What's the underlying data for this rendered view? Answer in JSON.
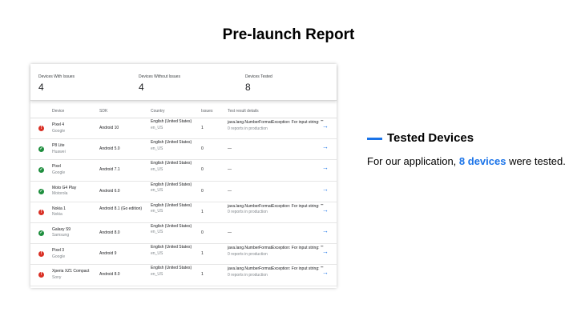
{
  "slide": {
    "title": "Pre-launch Report"
  },
  "summary": [
    {
      "label": "Devices With Issues",
      "value": "4"
    },
    {
      "label": "Devices Without Issues",
      "value": "4"
    },
    {
      "label": "Devices Tested",
      "value": "8"
    }
  ],
  "table": {
    "headers": {
      "device": "Device",
      "sdk": "SDK",
      "country": "Country",
      "issues": "Issues",
      "details": "Test result details"
    },
    "rows": [
      {
        "status": "error",
        "device": "Pixel 4",
        "maker": "Google",
        "sdk": "Android 10",
        "country": "English (United States)",
        "locale": "en_US",
        "issues": "1",
        "details": "java.lang.NumberFormatException: For input string: \"\"",
        "reports": "0 reports in production"
      },
      {
        "status": "ok",
        "device": "P8 Lite",
        "maker": "Huawei",
        "sdk": "Android 5.0",
        "country": "English (United States)",
        "locale": "en_US",
        "issues": "0",
        "details": "—",
        "reports": ""
      },
      {
        "status": "ok",
        "device": "Pixel",
        "maker": "Google",
        "sdk": "Android 7.1",
        "country": "English (United States)",
        "locale": "en_US",
        "issues": "0",
        "details": "—",
        "reports": ""
      },
      {
        "status": "ok",
        "device": "Moto G4 Play",
        "maker": "Motorola",
        "sdk": "Android 6.0",
        "country": "English (United States)",
        "locale": "en_US",
        "issues": "0",
        "details": "—",
        "reports": ""
      },
      {
        "status": "error",
        "device": "Nokia 1",
        "maker": "Nokia",
        "sdk": "Android 8.1 (Go edition)",
        "country": "English (United States)",
        "locale": "en_US",
        "issues": "1",
        "details": "java.lang.NumberFormatException: For input string: \"\"",
        "reports": "0 reports in production"
      },
      {
        "status": "ok",
        "device": "Galaxy S9",
        "maker": "Samsung",
        "sdk": "Android 8.0",
        "country": "English (United States)",
        "locale": "en_US",
        "issues": "0",
        "details": "—",
        "reports": ""
      },
      {
        "status": "error",
        "device": "Pixel 3",
        "maker": "Google",
        "sdk": "Android 9",
        "country": "English (United States)",
        "locale": "en_US",
        "issues": "1",
        "details": "java.lang.NumberFormatException: For input string: \"\"",
        "reports": "0 reports in production"
      },
      {
        "status": "error",
        "device": "Xperia XZ1 Compact",
        "maker": "Sony",
        "sdk": "Android 8.0",
        "country": "English (United States)",
        "locale": "en_US",
        "issues": "1",
        "details": "java.lang.NumberFormatException: For input string: \"\"",
        "reports": "0 reports in production"
      }
    ]
  },
  "side": {
    "title": "Tested Devices",
    "text_before": "For our application, ",
    "highlight": "8 devices",
    "text_after": " were tested.",
    "accent": "#1a73e8"
  },
  "icons": {
    "error": "error-icon",
    "ok": "check-circle-icon",
    "open": "arrow-right-icon"
  }
}
